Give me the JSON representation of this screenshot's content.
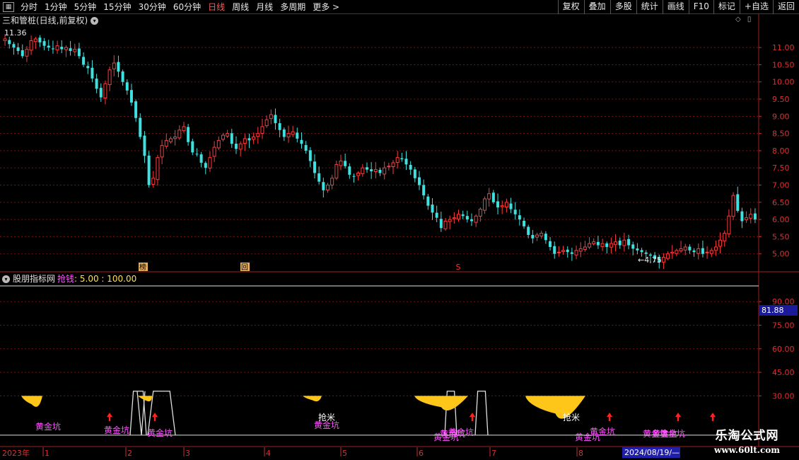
{
  "toolbar": {
    "icon": "grid-icon",
    "items": [
      "分时",
      "1分钟",
      "5分钟",
      "15分钟",
      "30分钟",
      "60分钟",
      "日线",
      "周线",
      "月线",
      "多周期",
      "更多 >"
    ],
    "active_index": 6,
    "right_buttons": [
      "复权",
      "叠加",
      "多股",
      "统计",
      "画线",
      "F10",
      "标记",
      "+自选",
      "返回"
    ]
  },
  "price_pane": {
    "title": "三和管桩(日线,前复权)",
    "high_label": "11.36",
    "low_label": "←4.75",
    "markers": [
      "榜",
      "回",
      "S"
    ],
    "y_ticks": [
      "11.00",
      "10.50",
      "10.00",
      "9.50",
      "9.00",
      "8.50",
      "8.00",
      "7.50",
      "7.00",
      "6.50",
      "6.00",
      "5.50",
      "5.00"
    ]
  },
  "indicator_pane": {
    "name": "股朋指标网",
    "label": "抢钱",
    "values": ": 5.00 : 100.00",
    "current_value": "81.88",
    "y_ticks": [
      "90.00",
      "75.00",
      "60.00",
      "45.00",
      "30.00"
    ],
    "annotations": [
      "黄金坑",
      "黄金坑",
      "黄金坑",
      "抢米",
      "黄金坑",
      "黄金坑",
      "黄金坑",
      "黄金坑",
      "抢米",
      "黄金坑",
      "黄金坑",
      "黄金坑",
      "黄金坑",
      "黄金坑"
    ]
  },
  "date_axis": {
    "year": "2023年",
    "months": [
      "1",
      "2",
      "3",
      "4",
      "5",
      "6",
      "7",
      "8"
    ],
    "cursor_date": "2024/08/19/—"
  },
  "watermark": {
    "title": "乐淘公式网",
    "url": "www.60lt.com"
  },
  "colors": {
    "up": "#ff3a3a",
    "down": "#3fe0e0",
    "gold": "#ffc61a",
    "magenta": "#ff55ff",
    "grid": "#7a1010",
    "arrow": "#ff2020"
  },
  "chart_data": {
    "type": "candlestick",
    "y_range": [
      4.5,
      11.6
    ],
    "closes": [
      11.25,
      11.1,
      11.0,
      10.9,
      10.75,
      10.95,
      11.2,
      11.25,
      11.15,
      11.05,
      11.0,
      10.95,
      11.05,
      10.95,
      11.0,
      10.9,
      10.95,
      10.75,
      10.5,
      10.4,
      10.1,
      9.8,
      9.55,
      9.95,
      10.35,
      10.55,
      10.3,
      10.0,
      9.75,
      9.4,
      8.95,
      8.4,
      7.85,
      7.0,
      7.2,
      7.8,
      8.15,
      8.3,
      8.35,
      8.4,
      8.6,
      8.7,
      8.25,
      7.95,
      7.9,
      7.65,
      7.5,
      7.8,
      8.1,
      8.3,
      8.45,
      8.5,
      8.2,
      8.05,
      8.2,
      8.35,
      8.3,
      8.4,
      8.5,
      8.7,
      8.9,
      9.05,
      8.8,
      8.6,
      8.4,
      8.5,
      8.55,
      8.35,
      8.2,
      8.0,
      7.7,
      7.35,
      7.1,
      6.85,
      7.0,
      7.2,
      7.6,
      7.7,
      7.55,
      7.3,
      7.25,
      7.35,
      7.5,
      7.45,
      7.4,
      7.45,
      7.35,
      7.5,
      7.55,
      7.65,
      7.8,
      7.75,
      7.6,
      7.45,
      7.2,
      7.0,
      6.7,
      6.4,
      6.2,
      6.05,
      5.75,
      5.95,
      6.0,
      6.05,
      6.15,
      6.1,
      6.0,
      5.95,
      6.1,
      6.3,
      6.6,
      6.75,
      6.5,
      6.35,
      6.4,
      6.5,
      6.3,
      6.15,
      6.0,
      5.8,
      5.55,
      5.45,
      5.55,
      5.6,
      5.4,
      5.2,
      5.0,
      5.05,
      5.1,
      5.05,
      5.0,
      5.1,
      5.15,
      5.2,
      5.3,
      5.35,
      5.25,
      5.3,
      5.2,
      5.3,
      5.35,
      5.25,
      5.4,
      5.25,
      5.15,
      5.1,
      5.05,
      5.0,
      4.95,
      4.85,
      4.75,
      4.9,
      5.0,
      5.05,
      5.1,
      5.15,
      5.2,
      5.1,
      5.05,
      5.15,
      5.0,
      5.05,
      5.1,
      5.2,
      5.4,
      5.6,
      6.1,
      6.7,
      6.25,
      5.95,
      6.05,
      6.15,
      6.0
    ]
  }
}
